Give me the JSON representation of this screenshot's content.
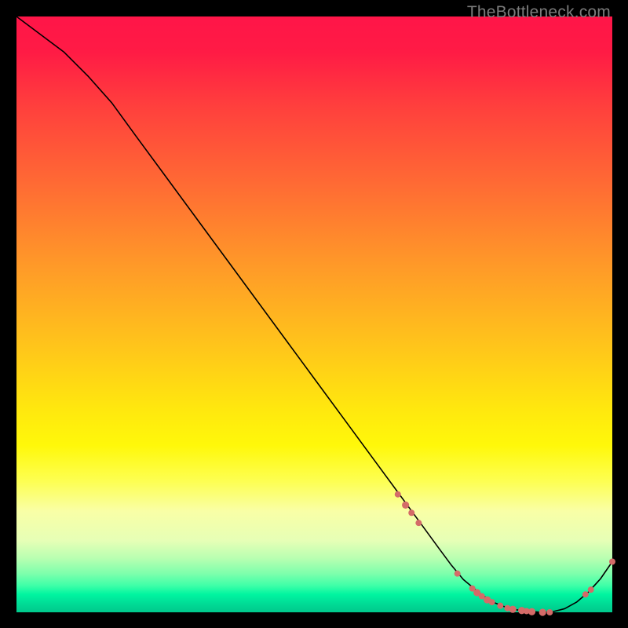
{
  "watermark": "TheBottleneck.com",
  "chart_data": {
    "type": "line",
    "title": "",
    "xlabel": "",
    "ylabel": "",
    "xlim": [
      0,
      100
    ],
    "ylim": [
      0,
      100
    ],
    "grid": false,
    "legend": false,
    "series": [
      {
        "name": "bottleneck-curve",
        "x": [
          0,
          4,
          8,
          12,
          16,
          20,
          25,
          30,
          35,
          40,
          45,
          50,
          55,
          60,
          65,
          68,
          71,
          73,
          75,
          78,
          80,
          82,
          84,
          86,
          88,
          90,
          92,
          94,
          96,
          98,
          100
        ],
        "y": [
          100,
          97,
          94,
          90,
          85.5,
          80,
          73.2,
          66.4,
          59.6,
          52.8,
          46,
          39.2,
          32.4,
          25.6,
          18.8,
          14.7,
          10.6,
          7.9,
          5.5,
          3.0,
          1.7,
          0.9,
          0.4,
          0.2,
          0.0,
          0.1,
          0.6,
          1.7,
          3.4,
          5.6,
          8.5
        ]
      }
    ],
    "markers": {
      "name": "highlight-points",
      "color": "#d46b68",
      "points": [
        {
          "x": 64.0,
          "y": 19.8,
          "r": 4.0
        },
        {
          "x": 65.3,
          "y": 18.0,
          "r": 4.6
        },
        {
          "x": 66.3,
          "y": 16.7,
          "r": 4.0
        },
        {
          "x": 67.5,
          "y": 15.0,
          "r": 4.0
        },
        {
          "x": 74.0,
          "y": 6.5,
          "r": 4.0
        },
        {
          "x": 76.5,
          "y": 4.0,
          "r": 4.0
        },
        {
          "x": 77.3,
          "y": 3.3,
          "r": 4.6
        },
        {
          "x": 78.1,
          "y": 2.7,
          "r": 4.0
        },
        {
          "x": 79.0,
          "y": 2.1,
          "r": 4.6
        },
        {
          "x": 79.8,
          "y": 1.7,
          "r": 4.0
        },
        {
          "x": 81.2,
          "y": 1.1,
          "r": 4.0
        },
        {
          "x": 82.4,
          "y": 0.7,
          "r": 4.0
        },
        {
          "x": 83.3,
          "y": 0.5,
          "r": 4.6
        },
        {
          "x": 84.8,
          "y": 0.3,
          "r": 4.6
        },
        {
          "x": 85.6,
          "y": 0.2,
          "r": 4.0
        },
        {
          "x": 86.5,
          "y": 0.1,
          "r": 4.6
        },
        {
          "x": 88.3,
          "y": 0.0,
          "r": 4.6
        },
        {
          "x": 89.5,
          "y": 0.0,
          "r": 4.0
        },
        {
          "x": 95.5,
          "y": 3.0,
          "r": 4.0
        },
        {
          "x": 96.4,
          "y": 3.8,
          "r": 4.0
        },
        {
          "x": 100.0,
          "y": 8.5,
          "r": 4.0
        }
      ]
    }
  }
}
